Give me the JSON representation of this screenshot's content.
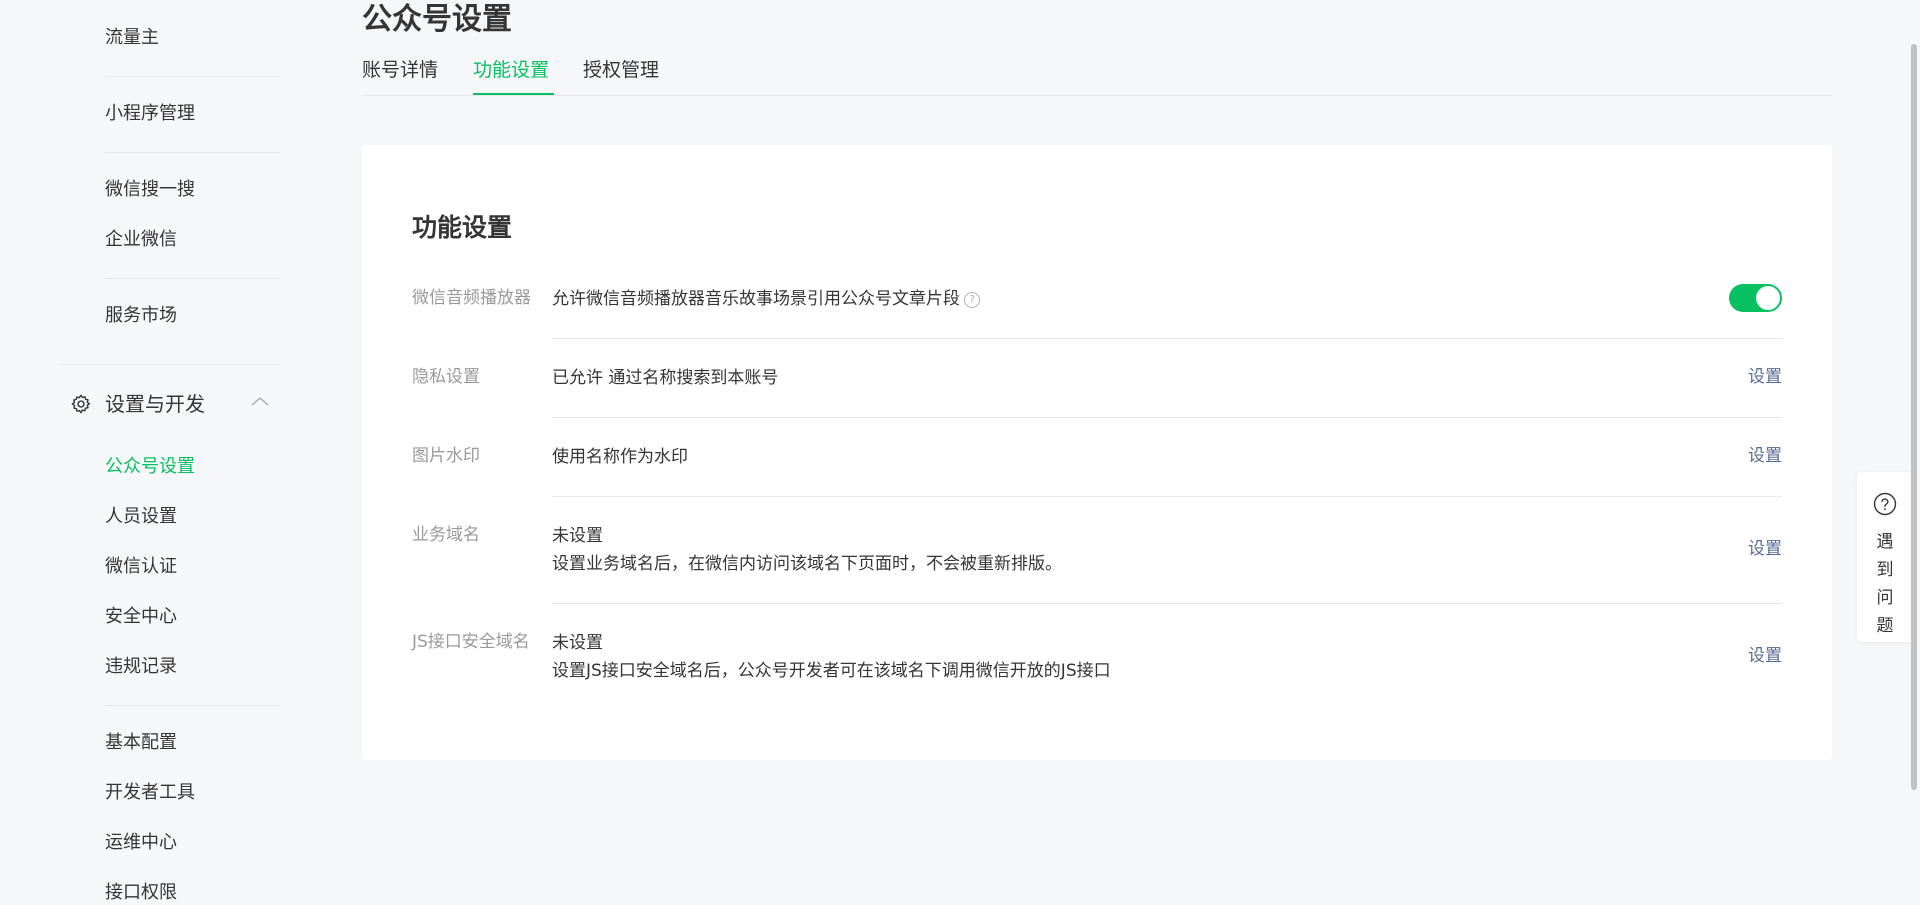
{
  "sidebar": {
    "items": [
      {
        "label": "流量主"
      },
      {
        "label": "小程序管理"
      },
      {
        "label": "微信搜一搜"
      },
      {
        "label": "企业微信"
      },
      {
        "label": "服务市场"
      }
    ],
    "section": {
      "label": "设置与开发",
      "icon": "gear-icon",
      "expanded": true,
      "items": [
        {
          "label": "公众号设置",
          "active": true
        },
        {
          "label": "人员设置"
        },
        {
          "label": "微信认证"
        },
        {
          "label": "安全中心"
        },
        {
          "label": "违规记录"
        },
        {
          "label": "基本配置"
        },
        {
          "label": "开发者工具"
        },
        {
          "label": "运维中心"
        },
        {
          "label": "接口权限"
        }
      ]
    }
  },
  "page": {
    "title": "公众号设置",
    "tabs": [
      {
        "label": "账号详情"
      },
      {
        "label": "功能设置",
        "active": true
      },
      {
        "label": "授权管理"
      }
    ]
  },
  "card": {
    "title": "功能设置",
    "rows": [
      {
        "label": "微信音频播放器",
        "value": "允许微信音频播放器音乐故事场景引用公众号文章片段",
        "help": "?",
        "toggle_on": true
      },
      {
        "label": "隐私设置",
        "value": "已允许 通过名称搜索到本账号",
        "action": "设置"
      },
      {
        "label": "图片水印",
        "value": "使用名称作为水印",
        "action": "设置"
      },
      {
        "label": "业务域名",
        "value": "未设置",
        "detail": "设置业务域名后，在微信内访问该域名下页面时，不会被重新排版。",
        "action": "设置"
      },
      {
        "label": "JS接口安全域名",
        "value": "未设置",
        "detail": "设置JS接口安全域名后，公众号开发者可在该域名下调用微信开放的JS接口",
        "action": "设置"
      }
    ]
  },
  "float_help": {
    "icon": "question-circle-icon",
    "chars": [
      "遇",
      "到",
      "问",
      "题"
    ]
  },
  "colors": {
    "accent": "#07c160",
    "link": "#576b95",
    "label": "#9a9a9a",
    "text": "#353535",
    "background": "#f6f7f9"
  }
}
